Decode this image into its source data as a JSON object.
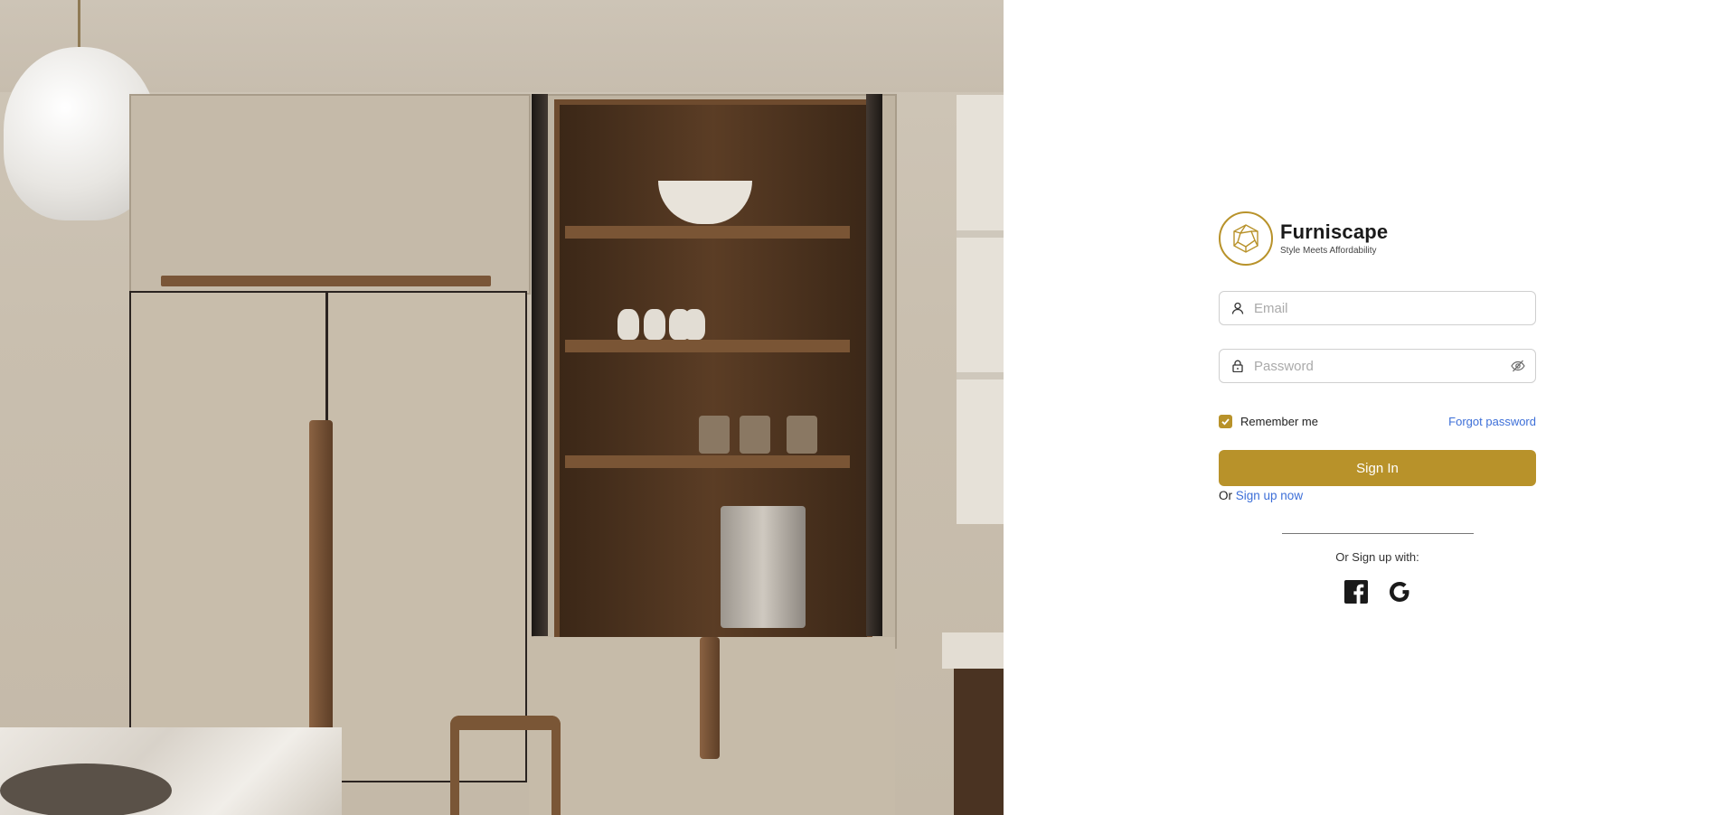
{
  "brand": {
    "name": "Furniscape",
    "tagline": "Style Meets Affordability",
    "logo_icon": "geometric-polyhedron-icon",
    "accent_color": "#b8922a"
  },
  "form": {
    "email": {
      "placeholder": "Email",
      "value": "",
      "icon": "user-icon"
    },
    "password": {
      "placeholder": "Password",
      "value": "",
      "icon": "lock-icon",
      "toggle_icon": "eye-off-icon"
    },
    "remember_me": {
      "label": "Remember me",
      "checked": true
    },
    "forgot_password": "Forgot password",
    "sign_in": "Sign In",
    "signup_prefix": "Or",
    "signup_link": "Sign up now"
  },
  "social": {
    "title": "Or Sign up with:",
    "providers": [
      {
        "name": "facebook",
        "icon": "facebook-icon"
      },
      {
        "name": "google",
        "icon": "google-icon"
      }
    ]
  },
  "hero": {
    "image": "kitchen-interior-photo"
  },
  "colors": {
    "link": "#3d6fd8",
    "accent": "#b8922a"
  }
}
